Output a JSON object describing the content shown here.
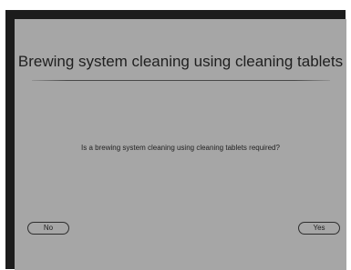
{
  "dialog": {
    "title": "Brewing system cleaning using cleaning tablets",
    "question": "Is a brewing system cleaning using cleaning tablets required?",
    "no_label": "No",
    "yes_label": "Yes"
  },
  "colors": {
    "screen_background": "#a6a6a6",
    "bezel": "#1c1c1c",
    "text": "#1f1f1f"
  }
}
